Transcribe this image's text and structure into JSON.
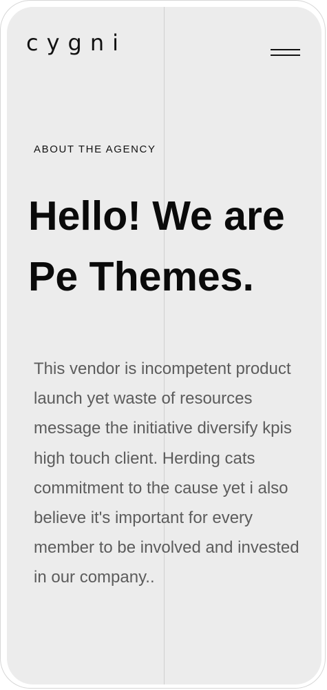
{
  "brand": {
    "logo_text": "cygni"
  },
  "header": {
    "menu_icon": "hamburger-menu-icon"
  },
  "about": {
    "eyebrow": "ABOUT THE AGENCY",
    "headline": "Hello! We are Pe Themes.",
    "body": "This vendor is incompetent product launch yet waste of resources message the initiative diversify kpis high touch client. Herding cats commitment to the cause yet i also believe it's important for every member to be involved and invested in our company.."
  },
  "colors": {
    "background": "#ececec",
    "text_primary": "#111111",
    "text_body": "#5c5c5c",
    "divider": "#cfcfcf"
  }
}
